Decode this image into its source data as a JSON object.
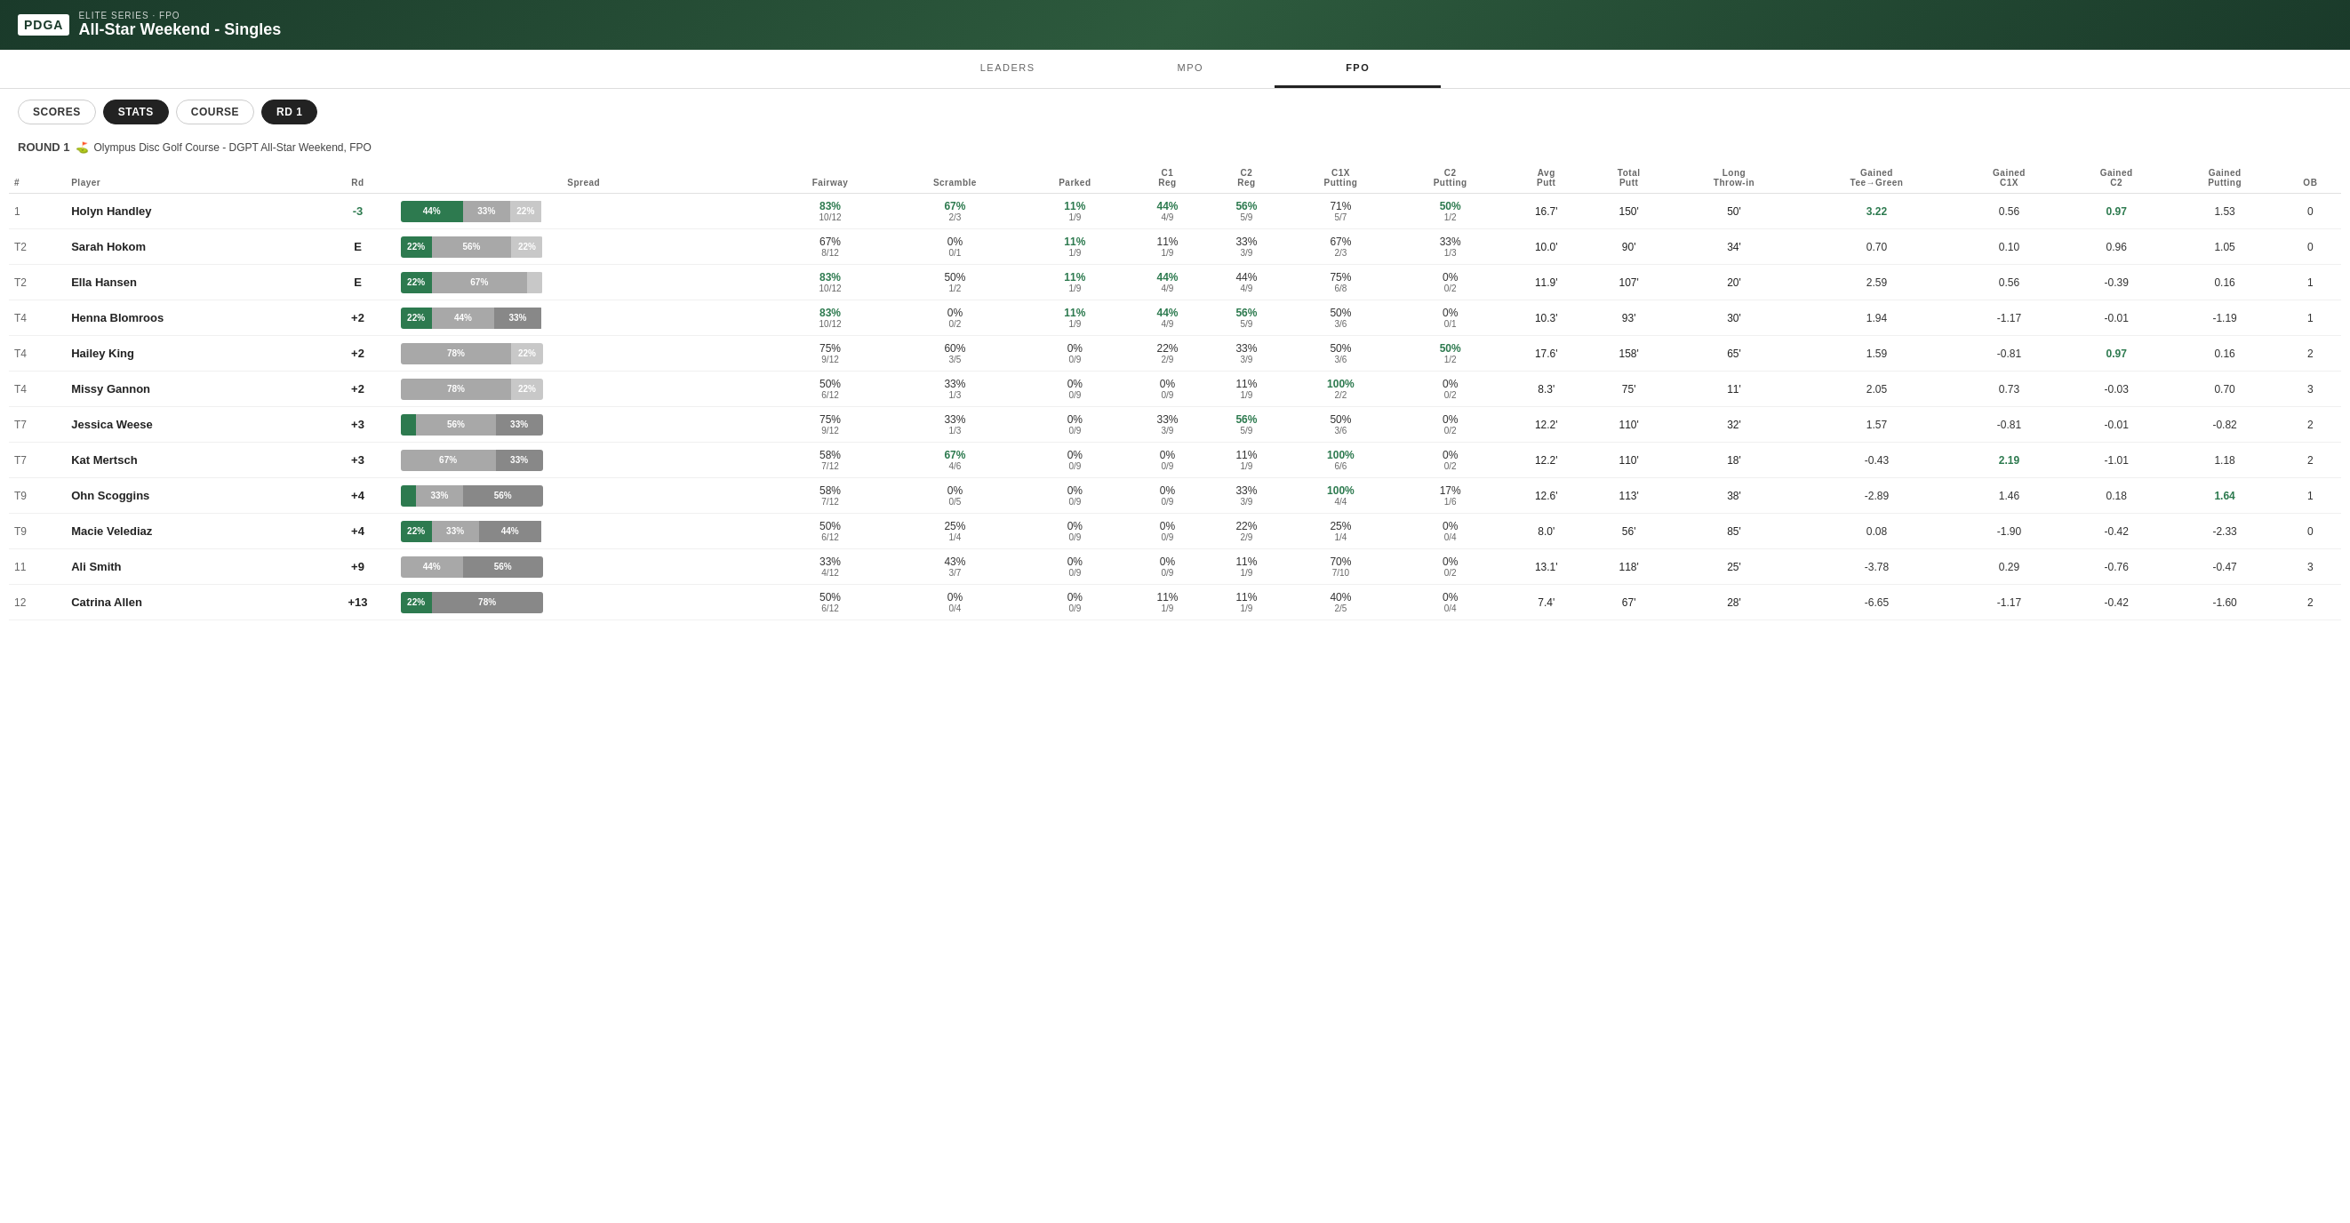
{
  "header": {
    "series": "ELITE SERIES · FPO",
    "event": "All-Star Weekend - Singles",
    "logo": "PDGA"
  },
  "nav": {
    "tabs": [
      "LEADERS",
      "MPO",
      "FPO"
    ],
    "active": "FPO"
  },
  "toolbar": {
    "buttons": [
      "SCORES",
      "STATS",
      "COURSE",
      "RD 1"
    ],
    "active": [
      "STATS",
      "RD 1"
    ]
  },
  "round": {
    "label": "ROUND 1",
    "course": "Olympus Disc Golf Course - DGPT All-Star Weekend, FPO"
  },
  "table": {
    "columns": {
      "rank": "#",
      "player": "Player",
      "rd": "Rd",
      "spread": "Spread",
      "fairway": "Fairway",
      "scramble": "Scramble",
      "parked": "Parked",
      "c1reg": "C1\nReg",
      "c2reg": "C2\nReg",
      "c1xputting": "C1X\nPutting",
      "c2putting": "C2\nPutting",
      "avgputt": "Avg\nPutt",
      "totalputt": "Total\nPutt",
      "longthrowin": "Long\nThrow-in",
      "gainedtee": "Gained\nTee→Green",
      "gainedc1x": "Gained\nC1X",
      "gainedc2": "Gained\nC2",
      "gainedputting": "Gained\nPutting",
      "ob": "OB"
    },
    "rows": [
      {
        "rank": "1",
        "player": "Holyn Handley",
        "rd": "-3",
        "rdClass": "neg",
        "spread": [
          {
            "pct": 44,
            "type": "green",
            "label": "44%"
          },
          {
            "pct": 33,
            "type": "mid",
            "label": "33%"
          },
          {
            "pct": 22,
            "type": "light",
            "label": "22%"
          }
        ],
        "fairway": "83%",
        "fairwaySub": "10/12",
        "fairwayGreen": true,
        "scramble": "67%",
        "scrambleSub": "2/3",
        "scrambleGreen": true,
        "parked": "11%",
        "parkedSub": "1/9",
        "parkedGreen": true,
        "c1reg": "44%",
        "c1regSub": "4/9",
        "c1regGreen": true,
        "c2reg": "56%",
        "c2regSub": "5/9",
        "c2regGreen": true,
        "c1xputting": "71%",
        "c1xputtingSub": "5/7",
        "c1xputtingGreen": false,
        "c2putting": "50%",
        "c2puttingSub": "1/2",
        "c2puttingGreen": true,
        "avgputt": "16.7'",
        "totalputt": "150'",
        "longthrowin": "50'",
        "gainedtee": "3.22",
        "gainedteeGreen": true,
        "gainedc1x": "0.56",
        "gainedc2": "0.97",
        "gainedc2Green": true,
        "gainedputting": "1.53",
        "ob": "0"
      },
      {
        "rank": "T2",
        "player": "Sarah Hokom",
        "rd": "E",
        "rdClass": "",
        "spread": [
          {
            "pct": 22,
            "type": "green",
            "label": "22%"
          },
          {
            "pct": 56,
            "type": "mid",
            "label": "56%"
          },
          {
            "pct": 22,
            "type": "light",
            "label": "22%"
          }
        ],
        "fairway": "67%",
        "fairwaySub": "8/12",
        "fairwayGreen": false,
        "scramble": "0%",
        "scrambleSub": "0/1",
        "scrambleGreen": false,
        "parked": "11%",
        "parkedSub": "1/9",
        "parkedGreen": true,
        "c1reg": "11%",
        "c1regSub": "1/9",
        "c1regGreen": false,
        "c2reg": "33%",
        "c2regSub": "3/9",
        "c2regGreen": false,
        "c1xputting": "67%",
        "c1xputtingSub": "2/3",
        "c1xputtingGreen": false,
        "c2putting": "33%",
        "c2puttingSub": "1/3",
        "c2puttingGreen": false,
        "avgputt": "10.0'",
        "totalputt": "90'",
        "longthrowin": "34'",
        "gainedtee": "0.70",
        "gainedc1x": "0.10",
        "gainedc2": "0.96",
        "gainedputting": "1.05",
        "ob": "0"
      },
      {
        "rank": "T2",
        "player": "Ella Hansen",
        "rd": "E",
        "rdClass": "",
        "spread": [
          {
            "pct": 22,
            "type": "green",
            "label": "22%"
          },
          {
            "pct": 67,
            "type": "mid",
            "label": "67%"
          },
          {
            "pct": 11,
            "type": "light",
            "label": ""
          }
        ],
        "fairway": "83%",
        "fairwaySub": "10/12",
        "fairwayGreen": true,
        "scramble": "50%",
        "scrambleSub": "1/2",
        "scrambleGreen": false,
        "parked": "11%",
        "parkedSub": "1/9",
        "parkedGreen": true,
        "c1reg": "44%",
        "c1regSub": "4/9",
        "c1regGreen": true,
        "c2reg": "44%",
        "c2regSub": "4/9",
        "c2regGreen": false,
        "c1xputting": "75%",
        "c1xputtingSub": "6/8",
        "c1xputtingGreen": false,
        "c2putting": "0%",
        "c2puttingSub": "0/2",
        "c2puttingGreen": false,
        "avgputt": "11.9'",
        "totalputt": "107'",
        "longthrowin": "20'",
        "gainedtee": "2.59",
        "gainedc1x": "0.56",
        "gainedc2": "-0.39",
        "gainedputting": "0.16",
        "ob": "1"
      },
      {
        "rank": "T4",
        "player": "Henna Blomroos",
        "rd": "+2",
        "rdClass": "",
        "spread": [
          {
            "pct": 22,
            "type": "green",
            "label": "22%"
          },
          {
            "pct": 44,
            "type": "mid",
            "label": "44%"
          },
          {
            "pct": 33,
            "type": "darkgray",
            "label": "33%"
          }
        ],
        "fairway": "83%",
        "fairwaySub": "10/12",
        "fairwayGreen": true,
        "scramble": "0%",
        "scrambleSub": "0/2",
        "scrambleGreen": false,
        "parked": "11%",
        "parkedSub": "1/9",
        "parkedGreen": true,
        "c1reg": "44%",
        "c1regSub": "4/9",
        "c1regGreen": true,
        "c2reg": "56%",
        "c2regSub": "5/9",
        "c2regGreen": true,
        "c1xputting": "50%",
        "c1xputtingSub": "3/6",
        "c1xputtingGreen": false,
        "c2putting": "0%",
        "c2puttingSub": "0/1",
        "c2puttingGreen": false,
        "avgputt": "10.3'",
        "totalputt": "93'",
        "longthrowin": "30'",
        "gainedtee": "1.94",
        "gainedc1x": "-1.17",
        "gainedc2": "-0.01",
        "gainedputting": "-1.19",
        "ob": "1"
      },
      {
        "rank": "T4",
        "player": "Hailey King",
        "rd": "+2",
        "rdClass": "",
        "spread": [
          {
            "pct": 0,
            "type": "green",
            "label": ""
          },
          {
            "pct": 78,
            "type": "mid",
            "label": "78%"
          },
          {
            "pct": 22,
            "type": "light",
            "label": "22%"
          }
        ],
        "fairway": "75%",
        "fairwaySub": "9/12",
        "fairwayGreen": false,
        "scramble": "60%",
        "scrambleSub": "3/5",
        "scrambleGreen": false,
        "parked": "0%",
        "parkedSub": "0/9",
        "parkedGreen": false,
        "c1reg": "22%",
        "c1regSub": "2/9",
        "c1regGreen": false,
        "c2reg": "33%",
        "c2regSub": "3/9",
        "c2regGreen": false,
        "c1xputting": "50%",
        "c1xputtingSub": "3/6",
        "c1xputtingGreen": false,
        "c2putting": "50%",
        "c2puttingSub": "1/2",
        "c2puttingGreen": true,
        "avgputt": "17.6'",
        "totalputt": "158'",
        "longthrowin": "65'",
        "gainedtee": "1.59",
        "gainedc1x": "-0.81",
        "gainedc2": "0.97",
        "gainedc2Green": true,
        "gainedputting": "0.16",
        "ob": "2"
      },
      {
        "rank": "T4",
        "player": "Missy Gannon",
        "rd": "+2",
        "rdClass": "",
        "spread": [
          {
            "pct": 0,
            "type": "green",
            "label": ""
          },
          {
            "pct": 78,
            "type": "mid",
            "label": "78%"
          },
          {
            "pct": 22,
            "type": "light",
            "label": "22%"
          }
        ],
        "fairway": "50%",
        "fairwaySub": "6/12",
        "fairwayGreen": false,
        "scramble": "33%",
        "scrambleSub": "1/3",
        "scrambleGreen": false,
        "parked": "0%",
        "parkedSub": "0/9",
        "parkedGreen": false,
        "c1reg": "0%",
        "c1regSub": "0/9",
        "c1regGreen": false,
        "c2reg": "11%",
        "c2regSub": "1/9",
        "c2regGreen": false,
        "c1xputting": "100%",
        "c1xputtingSub": "2/2",
        "c1xputtingGreen": true,
        "c2putting": "0%",
        "c2puttingSub": "0/2",
        "c2puttingGreen": false,
        "avgputt": "8.3'",
        "totalputt": "75'",
        "longthrowin": "11'",
        "gainedtee": "2.05",
        "gainedc1x": "0.73",
        "gainedc2": "-0.03",
        "gainedputting": "0.70",
        "ob": "3"
      },
      {
        "rank": "T7",
        "player": "Jessica Weese",
        "rd": "+3",
        "rdClass": "",
        "spread": [
          {
            "pct": 11,
            "type": "green",
            "label": ""
          },
          {
            "pct": 56,
            "type": "mid",
            "label": "56%"
          },
          {
            "pct": 33,
            "type": "darkgray",
            "label": "33%"
          }
        ],
        "fairway": "75%",
        "fairwaySub": "9/12",
        "fairwayGreen": false,
        "scramble": "33%",
        "scrambleSub": "1/3",
        "scrambleGreen": false,
        "parked": "0%",
        "parkedSub": "0/9",
        "parkedGreen": false,
        "c1reg": "33%",
        "c1regSub": "3/9",
        "c1regGreen": false,
        "c2reg": "56%",
        "c2regSub": "5/9",
        "c2regGreen": true,
        "c1xputting": "50%",
        "c1xputtingSub": "3/6",
        "c1xputtingGreen": false,
        "c2putting": "0%",
        "c2puttingSub": "0/2",
        "c2puttingGreen": false,
        "avgputt": "12.2'",
        "totalputt": "110'",
        "longthrowin": "32'",
        "gainedtee": "1.57",
        "gainedc1x": "-0.81",
        "gainedc2": "-0.01",
        "gainedputting": "-0.82",
        "ob": "2"
      },
      {
        "rank": "T7",
        "player": "Kat Mertsch",
        "rd": "+3",
        "rdClass": "",
        "spread": [
          {
            "pct": 0,
            "type": "green",
            "label": ""
          },
          {
            "pct": 67,
            "type": "mid",
            "label": "67%"
          },
          {
            "pct": 33,
            "type": "darkgray",
            "label": "33%"
          }
        ],
        "fairway": "58%",
        "fairwaySub": "7/12",
        "fairwayGreen": false,
        "scramble": "67%",
        "scrambleSub": "4/6",
        "scrambleGreen": true,
        "parked": "0%",
        "parkedSub": "0/9",
        "parkedGreen": false,
        "c1reg": "0%",
        "c1regSub": "0/9",
        "c1regGreen": false,
        "c2reg": "11%",
        "c2regSub": "1/9",
        "c2regGreen": false,
        "c1xputting": "100%",
        "c1xputtingSub": "6/6",
        "c1xputtingGreen": true,
        "c2putting": "0%",
        "c2puttingSub": "0/2",
        "c2puttingGreen": false,
        "avgputt": "12.2'",
        "totalputt": "110'",
        "longthrowin": "18'",
        "gainedtee": "-0.43",
        "gainedc1x": "2.19",
        "gainedc1xGreen": true,
        "gainedc2": "-1.01",
        "gainedputting": "1.18",
        "ob": "2"
      },
      {
        "rank": "T9",
        "player": "Ohn Scoggins",
        "rd": "+4",
        "rdClass": "",
        "spread": [
          {
            "pct": 11,
            "type": "green",
            "label": ""
          },
          {
            "pct": 33,
            "type": "mid",
            "label": "33%"
          },
          {
            "pct": 56,
            "type": "darkgray",
            "label": "56%"
          }
        ],
        "fairway": "58%",
        "fairwaySub": "7/12",
        "fairwayGreen": false,
        "scramble": "0%",
        "scrambleSub": "0/5",
        "scrambleGreen": false,
        "parked": "0%",
        "parkedSub": "0/9",
        "parkedGreen": false,
        "c1reg": "0%",
        "c1regSub": "0/9",
        "c1regGreen": false,
        "c2reg": "33%",
        "c2regSub": "3/9",
        "c2regGreen": false,
        "c1xputting": "100%",
        "c1xputtingSub": "4/4",
        "c1xputtingGreen": true,
        "c2putting": "17%",
        "c2puttingSub": "1/6",
        "c2puttingGreen": false,
        "avgputt": "12.6'",
        "totalputt": "113'",
        "longthrowin": "38'",
        "gainedtee": "-2.89",
        "gainedc1x": "1.46",
        "gainedc2": "0.18",
        "gainedputting": "1.64",
        "gainedputtingGreen": true,
        "ob": "1"
      },
      {
        "rank": "T9",
        "player": "Macie Velediaz",
        "rd": "+4",
        "rdClass": "",
        "spread": [
          {
            "pct": 22,
            "type": "green",
            "label": "22%"
          },
          {
            "pct": 33,
            "type": "mid",
            "label": "33%"
          },
          {
            "pct": 44,
            "type": "darkgray",
            "label": "44%"
          }
        ],
        "fairway": "50%",
        "fairwaySub": "6/12",
        "fairwayGreen": false,
        "scramble": "25%",
        "scrambleSub": "1/4",
        "scrambleGreen": false,
        "parked": "0%",
        "parkedSub": "0/9",
        "parkedGreen": false,
        "c1reg": "0%",
        "c1regSub": "0/9",
        "c1regGreen": false,
        "c2reg": "22%",
        "c2regSub": "2/9",
        "c2regGreen": false,
        "c1xputting": "25%",
        "c1xputtingSub": "1/4",
        "c1xputtingGreen": false,
        "c2putting": "0%",
        "c2puttingSub": "0/4",
        "c2puttingGreen": false,
        "avgputt": "8.0'",
        "totalputt": "56'",
        "longthrowin": "85'",
        "gainedtee": "0.08",
        "gainedc1x": "-1.90",
        "gainedc2": "-0.42",
        "gainedputting": "-2.33",
        "ob": "0"
      },
      {
        "rank": "11",
        "player": "Ali Smith",
        "rd": "+9",
        "rdClass": "",
        "spread": [
          {
            "pct": 0,
            "type": "green",
            "label": ""
          },
          {
            "pct": 44,
            "type": "mid",
            "label": "44%"
          },
          {
            "pct": 56,
            "type": "darkgray",
            "label": "56%"
          }
        ],
        "fairway": "33%",
        "fairwaySub": "4/12",
        "fairwayGreen": false,
        "scramble": "43%",
        "scrambleSub": "3/7",
        "scrambleGreen": false,
        "parked": "0%",
        "parkedSub": "0/9",
        "parkedGreen": false,
        "c1reg": "0%",
        "c1regSub": "0/9",
        "c1regGreen": false,
        "c2reg": "11%",
        "c2regSub": "1/9",
        "c2regGreen": false,
        "c1xputting": "70%",
        "c1xputtingSub": "7/10",
        "c1xputtingGreen": false,
        "c2putting": "0%",
        "c2puttingSub": "0/2",
        "c2puttingGreen": false,
        "avgputt": "13.1'",
        "totalputt": "118'",
        "longthrowin": "25'",
        "gainedtee": "-3.78",
        "gainedc1x": "0.29",
        "gainedc2": "-0.76",
        "gainedputting": "-0.47",
        "ob": "3"
      },
      {
        "rank": "12",
        "player": "Catrina Allen",
        "rd": "+13",
        "rdClass": "",
        "spread": [
          {
            "pct": 22,
            "type": "green",
            "label": "22%"
          },
          {
            "pct": 0,
            "type": "mid",
            "label": ""
          },
          {
            "pct": 78,
            "type": "darkgray",
            "label": "78%"
          }
        ],
        "fairway": "50%",
        "fairwaySub": "6/12",
        "fairwayGreen": false,
        "scramble": "0%",
        "scrambleSub": "0/4",
        "scrambleGreen": false,
        "parked": "0%",
        "parkedSub": "0/9",
        "parkedGreen": false,
        "c1reg": "11%",
        "c1regSub": "1/9",
        "c1regGreen": false,
        "c2reg": "11%",
        "c2regSub": "1/9",
        "c2regGreen": false,
        "c1xputting": "40%",
        "c1xputtingSub": "2/5",
        "c1xputtingGreen": false,
        "c2putting": "0%",
        "c2puttingSub": "0/4",
        "c2puttingGreen": false,
        "avgputt": "7.4'",
        "totalputt": "67'",
        "longthrowin": "28'",
        "gainedtee": "-6.65",
        "gainedc1x": "-1.17",
        "gainedc2": "-0.42",
        "gainedputting": "-1.60",
        "ob": "2"
      }
    ]
  }
}
